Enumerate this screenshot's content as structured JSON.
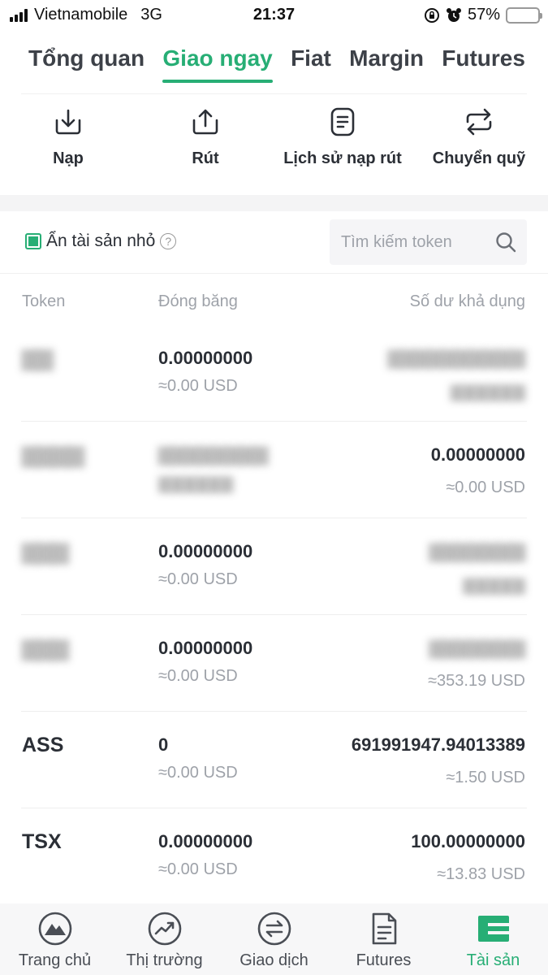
{
  "status_bar": {
    "carrier": "Vietnamobile",
    "network": "3G",
    "time": "21:37",
    "battery": "57%",
    "battery_level": 0.57
  },
  "tabs": [
    {
      "label": "Tổng quan",
      "active": false
    },
    {
      "label": "Giao ngay",
      "active": true
    },
    {
      "label": "Fiat",
      "active": false
    },
    {
      "label": "Margin",
      "active": false
    },
    {
      "label": "Futures",
      "active": false
    }
  ],
  "actions": [
    {
      "label": "Nạp",
      "icon": "deposit-icon"
    },
    {
      "label": "Rút",
      "icon": "withdraw-icon"
    },
    {
      "label": "Lịch sử nạp rút",
      "icon": "history-icon"
    },
    {
      "label": "Chuyển quỹ",
      "icon": "transfer-icon"
    }
  ],
  "filter": {
    "hide_small_label": "Ẩn tài sản nhỏ",
    "hide_small_checked": true,
    "search_placeholder": "Tìm kiếm token"
  },
  "table": {
    "headers": {
      "token": "Token",
      "frozen": "Đóng băng",
      "available": "Số dư khả dụng"
    },
    "rows": [
      {
        "token": "",
        "frozen": "0.00000000",
        "frozen_usd": "≈0.00 USD",
        "available": "",
        "available_usd": ""
      },
      {
        "token": "",
        "frozen": "",
        "frozen_usd": "",
        "available": "0.00000000",
        "available_usd": "≈0.00 USD"
      },
      {
        "token": "",
        "frozen": "0.00000000",
        "frozen_usd": "≈0.00 USD",
        "available": "",
        "available_usd": ""
      },
      {
        "token": "",
        "frozen": "0.00000000",
        "frozen_usd": "≈0.00 USD",
        "available": "",
        "available_usd": "≈353.19 USD"
      },
      {
        "token": "ASS",
        "frozen": "0",
        "frozen_usd": "≈0.00 USD",
        "available": "691991947.94013389",
        "available_usd": "≈1.50 USD"
      },
      {
        "token": "TSX",
        "frozen": "0.00000000",
        "frozen_usd": "≈0.00 USD",
        "available": "100.00000000",
        "available_usd": "≈13.83 USD"
      }
    ]
  },
  "bottom_nav": [
    {
      "label": "Trang chủ",
      "icon": "home-icon",
      "active": false
    },
    {
      "label": "Thị trường",
      "icon": "market-icon",
      "active": false
    },
    {
      "label": "Giao dịch",
      "icon": "trade-icon",
      "active": false
    },
    {
      "label": "Futures",
      "icon": "futures-icon",
      "active": false
    },
    {
      "label": "Tài sản",
      "icon": "assets-icon",
      "active": true
    }
  ],
  "colors": {
    "accent": "#27ae75",
    "text": "#2b2f36",
    "muted": "#9ea2a9",
    "battery": "#f5c518"
  }
}
